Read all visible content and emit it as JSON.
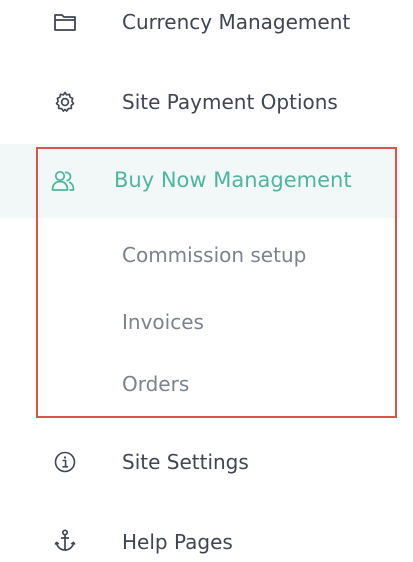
{
  "menu": {
    "currency_management": {
      "label": "Currency Management",
      "icon": "folder-icon"
    },
    "site_payment_options": {
      "label": "Site Payment Options",
      "icon": "gear-icon"
    },
    "buy_now_management": {
      "label": "Buy Now Management",
      "icon": "users-icon",
      "active": true,
      "submenu": [
        {
          "label": "Commission setup"
        },
        {
          "label": "Invoices"
        },
        {
          "label": "Orders"
        }
      ]
    },
    "site_settings": {
      "label": "Site Settings",
      "icon": "info-icon"
    },
    "help_pages": {
      "label": "Help Pages",
      "icon": "anchor-icon"
    }
  },
  "colors": {
    "accent": "#4fb5a2",
    "active_background": "#f1f8f7",
    "text": "#3f4651",
    "submenu_text": "#7d838d",
    "highlight_border": "#d9534f"
  }
}
